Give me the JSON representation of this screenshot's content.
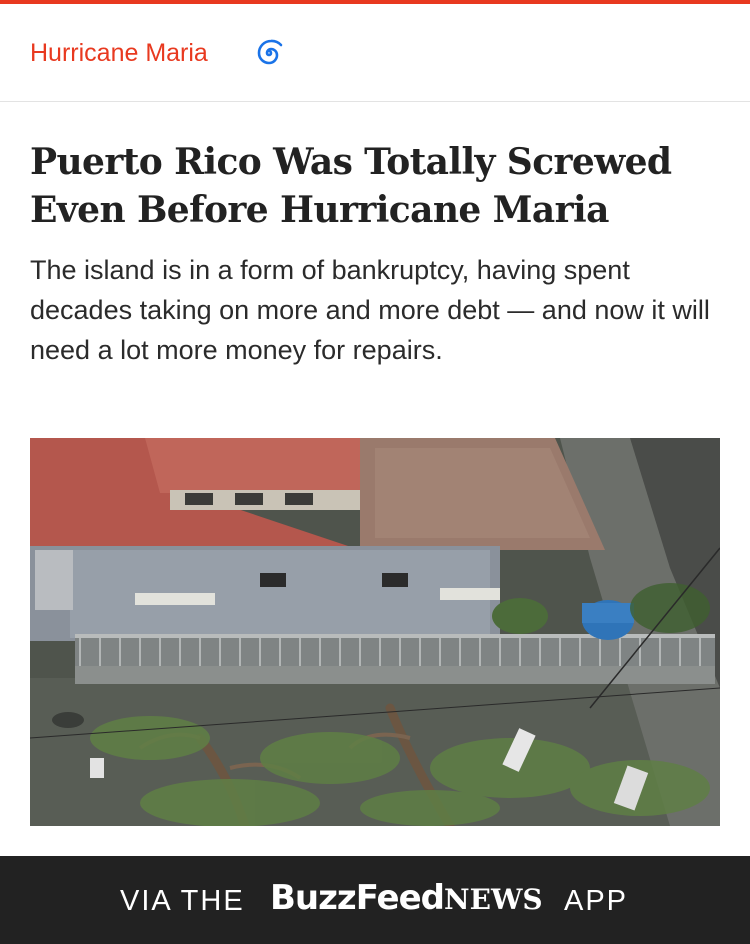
{
  "topic": {
    "label": "Hurricane Maria",
    "icon": "hurricane-spiral-icon",
    "accent_color": "#e8391f",
    "icon_color": "#1a73e8"
  },
  "article": {
    "headline": "Puerto Rico Was Totally Screwed Even Before Hurricane Maria",
    "dek": "The island is in a form of bankruptcy, having spent decades taking on more and more debt — and now it will need a lot more money for repairs."
  },
  "footer": {
    "via_text": "VIA THE",
    "brand_buzzfeed": "BuzzFeed",
    "brand_news": "NEWS",
    "app_text": "APP",
    "background_color": "#222222"
  }
}
